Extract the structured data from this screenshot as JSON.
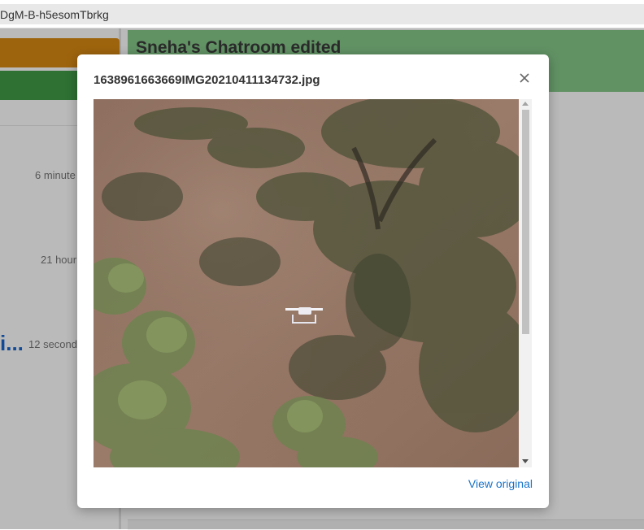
{
  "browser": {
    "url_fragment": "DgM-B-h5esomTbrkg"
  },
  "sidebar": {
    "times": [
      "6 minute",
      "21 hour",
      "12 second"
    ],
    "truncated_name": "i..."
  },
  "chat": {
    "title": "Sneha's Chatroom edited"
  },
  "modal": {
    "filename": "1638961663669IMG20210411134732.jpg",
    "close_icon": "close-icon",
    "view_original_label": "View original",
    "image_description_icon": "drone-photo"
  },
  "colors": {
    "orange": "#d98a12",
    "green_button": "#3f9b46",
    "header_green": "#86c98a",
    "link_blue": "#1a73c8"
  }
}
